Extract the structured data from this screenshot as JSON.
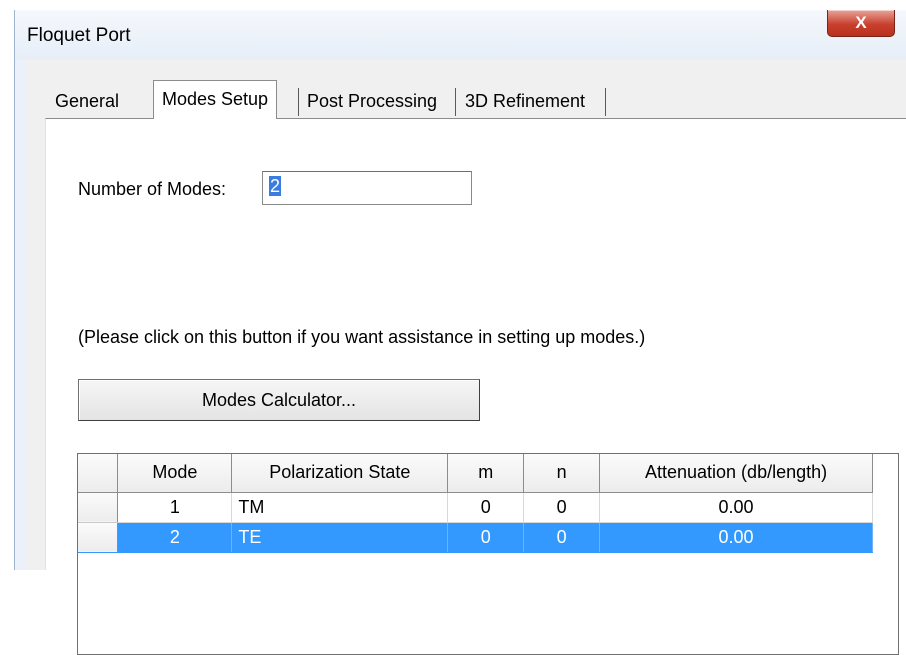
{
  "window": {
    "title": "Floquet Port",
    "close_label": "X"
  },
  "tabs": [
    {
      "label": "General",
      "active": false
    },
    {
      "label": "Modes Setup",
      "active": true
    },
    {
      "label": "Post Processing",
      "active": false
    },
    {
      "label": "3D Refinement",
      "active": false
    }
  ],
  "modes_setup": {
    "number_of_modes_label": "Number of Modes:",
    "number_of_modes_value": "2",
    "hint": "(Please click on this button if you want assistance in setting up modes.)",
    "calculator_button": "Modes Calculator..."
  },
  "table": {
    "columns": [
      "Mode",
      "Polarization State",
      "m",
      "n",
      "Attenuation (db/length)"
    ],
    "rows": [
      {
        "mode": "1",
        "polarization": "TM",
        "m": "0",
        "n": "0",
        "attenuation": "0.00",
        "selected": false
      },
      {
        "mode": "2",
        "polarization": "TE",
        "m": "0",
        "n": "0",
        "attenuation": "0.00",
        "selected": true
      }
    ]
  },
  "colors": {
    "selection": "#3399ff",
    "close_button": "#c9402d"
  }
}
